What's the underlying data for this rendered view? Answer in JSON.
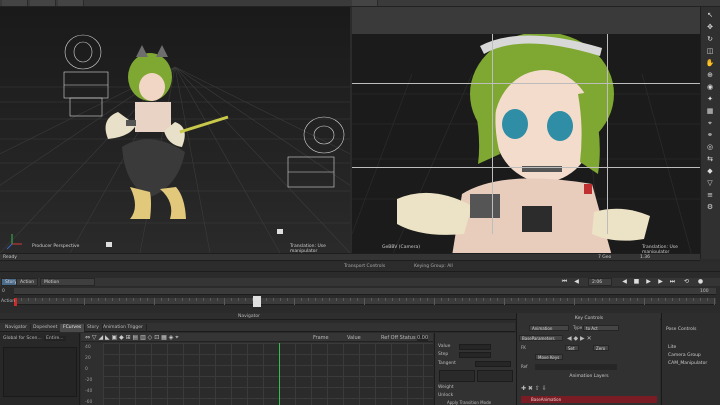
{
  "viewports": {
    "left_label": "Producer Perspective",
    "left_hint": "Translation: Use manipulator",
    "right_label": "GeBBV (Camera)",
    "right_hint": "Translation: Use manipulator"
  },
  "status": {
    "ready": "Ready",
    "fps_left": "7 Geo",
    "right_readout": "1.36"
  },
  "transport": {
    "title": "Transport Controls",
    "subtitle": "Keying Group: All",
    "story_label": "Story",
    "action_label": "Action",
    "edit_label": "Motion",
    "frame_start": "0",
    "frame_end": "100",
    "time_value": "2:06"
  },
  "timeline": {
    "layer_label": "Action",
    "playhead_percent": 34
  },
  "navigator": {
    "header": "Navigator",
    "tabs": [
      "Navigator",
      "Dopesheet",
      "FCurves",
      "Story",
      "Animation Trigger"
    ],
    "active_tab": 2,
    "left_filter": "Global for Scen...",
    "left_filter_value": "Entire...",
    "fcurve_tools": [
      "Frame",
      "Value",
      "Ref Off Status",
      "0.00"
    ],
    "y_labels": [
      "40",
      "20",
      "0",
      "-20",
      "-40",
      "-60"
    ]
  },
  "properties": {
    "value_label": "Value",
    "step_label": "Step",
    "tangent_label": "Tangent",
    "weight_label": "Weight",
    "unlock_label": "Unlock",
    "footer": "Apply Transition Mode"
  },
  "key_controls": {
    "title": "Key Controls",
    "animation_btn": "Animation",
    "type_label": "Type",
    "type_value": "to Act",
    "base_btn": "BaseParameters",
    "move_btn": "Move Keys",
    "set_btn": "Set",
    "zero_btn": "Zero",
    "fk_label": "FK",
    "ref_label": "Ref",
    "anim_layers_title": "Animation Layers",
    "base_layer": "BaseAnimation"
  },
  "pose_controls": {
    "title": "Pose Controls",
    "properties_tab": "Properties",
    "items": [
      "Lite",
      "Camera Group",
      "CAM_Manipulator"
    ]
  },
  "colors": {
    "playhead": "#2ec24a",
    "layer_red": "#7a1c24",
    "timeline_marker": "#cc2b2b"
  }
}
